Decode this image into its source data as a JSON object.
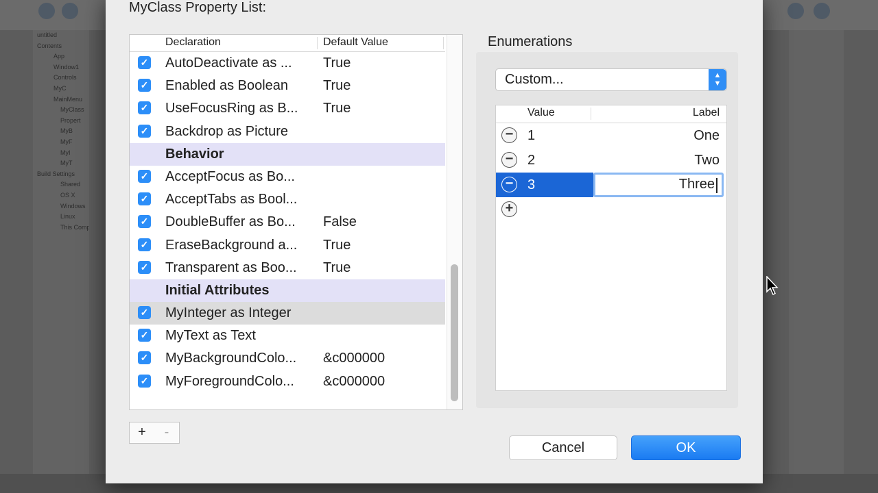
{
  "background": {
    "sidebar_items": [
      "untitled",
      "Contents",
      "App",
      "Window1",
      "Controls",
      "MyC",
      "MainMenu",
      "MyClass",
      "Propert",
      "MyB",
      "MyF",
      "MyI",
      "MyT",
      "Build Settings",
      "Shared",
      "OS X",
      "Windows",
      "Linux",
      "This Comp"
    ]
  },
  "sheet": {
    "title": "MyClass Property List:"
  },
  "property_list": {
    "columns": [
      "Declaration",
      "Default Value"
    ],
    "rows": [
      {
        "type": "item",
        "checked": true,
        "name": "AutoDeactivate as ...",
        "value": "True"
      },
      {
        "type": "item",
        "checked": true,
        "name": "Enabled as Boolean",
        "value": "True"
      },
      {
        "type": "item",
        "checked": true,
        "name": "UseFocusRing as B...",
        "value": "True"
      },
      {
        "type": "item",
        "checked": true,
        "name": "Backdrop as Picture",
        "value": ""
      },
      {
        "type": "section",
        "name": "Behavior"
      },
      {
        "type": "item",
        "checked": true,
        "name": "AcceptFocus as Bo...",
        "value": ""
      },
      {
        "type": "item",
        "checked": true,
        "name": "AcceptTabs as Bool...",
        "value": ""
      },
      {
        "type": "item",
        "checked": true,
        "name": "DoubleBuffer as Bo...",
        "value": "False"
      },
      {
        "type": "item",
        "checked": true,
        "name": "EraseBackground a...",
        "value": "True"
      },
      {
        "type": "item",
        "checked": true,
        "name": "Transparent as Boo...",
        "value": "True"
      },
      {
        "type": "section",
        "name": "Initial Attributes"
      },
      {
        "type": "item",
        "checked": true,
        "name": "MyInteger as Integer",
        "value": "",
        "selected": true
      },
      {
        "type": "item",
        "checked": true,
        "name": "MyText as Text",
        "value": ""
      },
      {
        "type": "item",
        "checked": true,
        "name": "MyBackgroundColo...",
        "value": "&c000000"
      },
      {
        "type": "item",
        "checked": true,
        "name": "MyForegroundColo...",
        "value": "&c000000"
      }
    ],
    "add_label": "+",
    "remove_label": "-",
    "checkmark": "✓"
  },
  "enumerations": {
    "heading": "Enumerations",
    "popup_value": "Custom...",
    "columns": [
      "Value",
      "Label"
    ],
    "rows": [
      {
        "value": "1",
        "label": "One"
      },
      {
        "value": "2",
        "label": "Two"
      },
      {
        "value": "3",
        "label": "Three",
        "selected": true,
        "editing": true
      }
    ],
    "minus_glyph": "−",
    "plus_glyph": "+"
  },
  "buttons": {
    "cancel": "Cancel",
    "ok": "OK"
  },
  "colors": {
    "accent": "#1b66d6",
    "section_bg": "#e3e1f7",
    "checkbox": "#2c8ef8"
  }
}
